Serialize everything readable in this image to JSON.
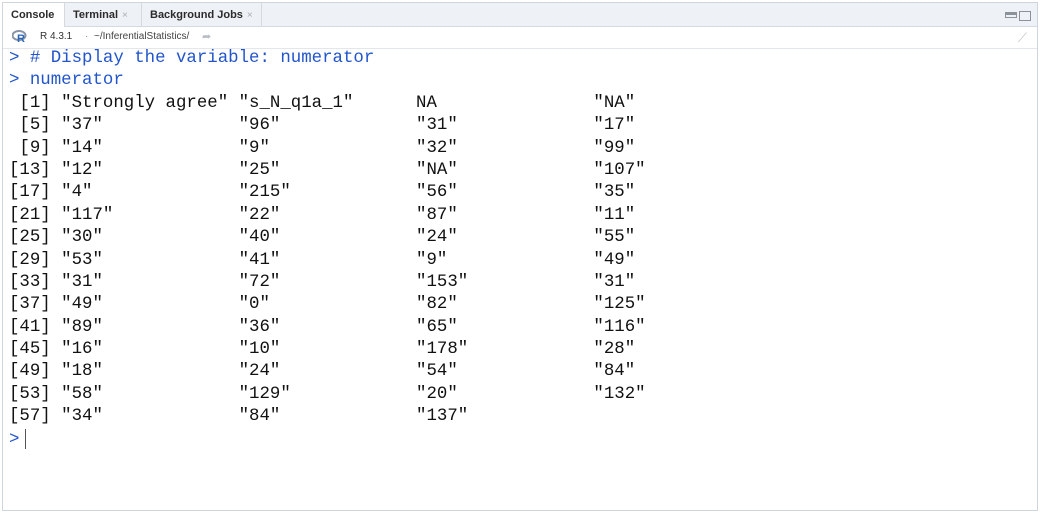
{
  "tabs": [
    {
      "label": "Console",
      "closable": false
    },
    {
      "label": "Terminal",
      "closable": true,
      "close_glyph": "×"
    },
    {
      "label": "Background Jobs",
      "closable": true,
      "close_glyph": "×"
    }
  ],
  "pathbar": {
    "icon": "r-logo-icon",
    "r_version": "R 4.3.1",
    "separator": "·",
    "path": "~/InferentialStatistics/",
    "goto_icon": "arrow-right-icon",
    "clear_icon": "broom-icon"
  },
  "console": {
    "prompt": ">",
    "commands": [
      "# Display the variable: numerator",
      "numerator"
    ],
    "output_lines": [
      " [1] \"Strongly agree\" \"s_N_q1a_1\"      NA               \"NA\"",
      " [5] \"37\"             \"96\"             \"31\"             \"17\"",
      " [9] \"14\"             \"9\"              \"32\"             \"99\"",
      "[13] \"12\"             \"25\"             \"NA\"             \"107\"",
      "[17] \"4\"              \"215\"            \"56\"             \"35\"",
      "[21] \"117\"            \"22\"             \"87\"             \"11\"",
      "[25] \"30\"             \"40\"             \"24\"             \"55\"",
      "[29] \"53\"             \"41\"             \"9\"              \"49\"",
      "[33] \"31\"             \"72\"             \"153\"            \"31\"",
      "[37] \"49\"             \"0\"              \"82\"             \"125\"",
      "[41] \"89\"             \"36\"             \"65\"             \"116\"",
      "[45] \"16\"             \"10\"             \"178\"            \"28\"",
      "[49] \"18\"             \"24\"             \"54\"             \"84\"",
      "[53] \"58\"             \"129\"            \"20\"             \"132\"",
      "[57] \"34\"             \"84\"             \"137\""
    ]
  },
  "colors": {
    "prompt": "#2255cc",
    "output": "#111111"
  }
}
